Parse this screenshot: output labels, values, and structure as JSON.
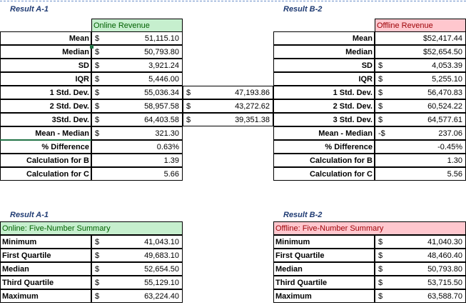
{
  "titles": {
    "a_top": "Result A-1",
    "b_top": "Result B-2",
    "a_bottom": "Result A-1",
    "b_bottom": "Result B-2"
  },
  "headers": {
    "online": "Online Revenue",
    "offline": "Offline Revenue",
    "online_five": "Online: Five-Number Summary",
    "offline_five": "Offline: Five-Number Summary"
  },
  "stats_a": [
    {
      "label": "Mean",
      "sign": "$",
      "value": "51,115.10",
      "extra_sign": "",
      "extra": ""
    },
    {
      "label": "Median",
      "sign": "$",
      "value": "50,793.80",
      "extra_sign": "",
      "extra": ""
    },
    {
      "label": "SD",
      "sign": "$",
      "value": "3,921.24",
      "extra_sign": "",
      "extra": ""
    },
    {
      "label": "IQR",
      "sign": "$",
      "value": "5,446.00",
      "extra_sign": "",
      "extra": ""
    },
    {
      "label": "1 Std. Dev.",
      "sign": "$",
      "value": "55,036.34",
      "extra_sign": "$",
      "extra": "47,193.86"
    },
    {
      "label": "2 Std. Dev.",
      "sign": "$",
      "value": "58,957.58",
      "extra_sign": "$",
      "extra": "43,272.62"
    },
    {
      "label": "3Std. Dev.",
      "sign": "$",
      "value": "64,403.58",
      "extra_sign": "$",
      "extra": "39,351.38"
    },
    {
      "label": "Mean - Median",
      "sign": "$",
      "value": "321.30",
      "extra_sign": "",
      "extra": ""
    },
    {
      "label": "% Difference",
      "sign": "",
      "value": "0.63%",
      "extra_sign": "",
      "extra": ""
    },
    {
      "label": "Calculation for B",
      "sign": "",
      "value": "1.39",
      "extra_sign": "",
      "extra": ""
    },
    {
      "label": "Calculation for C",
      "sign": "",
      "value": "5.66",
      "extra_sign": "",
      "extra": ""
    }
  ],
  "stats_b": [
    {
      "label": "Mean",
      "sign": "",
      "value": "$52,417.44"
    },
    {
      "label": "Median",
      "sign": "",
      "value": "$52,654.50"
    },
    {
      "label": "SD",
      "sign": "$",
      "value": "4,053.39"
    },
    {
      "label": "IQR",
      "sign": "$",
      "value": "5,255.10"
    },
    {
      "label": "1 Std. Dev.",
      "sign": "$",
      "value": "56,470.83"
    },
    {
      "label": "2 Std. Dev.",
      "sign": "$",
      "value": "60,524.22"
    },
    {
      "label": "3 Std. Dev.",
      "sign": "$",
      "value": "64,577.61"
    },
    {
      "label": "Mean - Median",
      "sign": "-$",
      "value": "237.06"
    },
    {
      "label": "% Difference",
      "sign": "",
      "value": "-0.45%"
    },
    {
      "label": "Calculation for B",
      "sign": "",
      "value": "1.30"
    },
    {
      "label": "Calculation for C",
      "sign": "",
      "value": "5.56"
    }
  ],
  "five_a": [
    {
      "label": "Minimum",
      "sign": "$",
      "value": "41,043.10"
    },
    {
      "label": "First Quartile",
      "sign": "$",
      "value": "49,683.10"
    },
    {
      "label": "Median",
      "sign": "$",
      "value": "52,654.50"
    },
    {
      "label": "Third Quartile",
      "sign": "$",
      "value": "55,129.10"
    },
    {
      "label": "Maximum",
      "sign": "$",
      "value": "63,224.40"
    }
  ],
  "five_b": [
    {
      "label": "Minimum",
      "sign": "$",
      "value": "41,040.30"
    },
    {
      "label": "First Quartile",
      "sign": "$",
      "value": "48,460.40"
    },
    {
      "label": "Median",
      "sign": "$",
      "value": "50,793.80"
    },
    {
      "label": "Third Quartile",
      "sign": "$",
      "value": "53,715.50"
    },
    {
      "label": "Maximum",
      "sign": "$",
      "value": "63,588.70"
    }
  ],
  "colors": {
    "online_fill": "#c6efce",
    "offline_fill": "#ffc7ce",
    "title": "#1f3b73",
    "selection": "#217346"
  }
}
